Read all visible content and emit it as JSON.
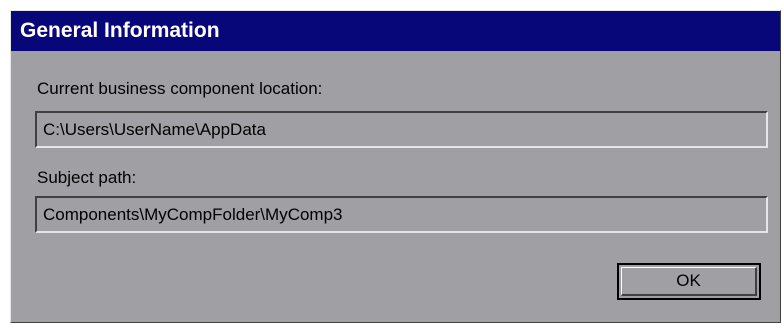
{
  "window": {
    "title": "General Information"
  },
  "location": {
    "label": "Current business component location:",
    "value": "C:\\Users\\UserName\\AppData"
  },
  "subject": {
    "label": "Subject path:",
    "value": "Components\\MyCompFolder\\MyComp3"
  },
  "buttons": {
    "ok_label": "OK"
  },
  "colors": {
    "titlebar": "#07077a",
    "dialog_background": "#a0a0a4",
    "title_text": "#ffffff"
  }
}
